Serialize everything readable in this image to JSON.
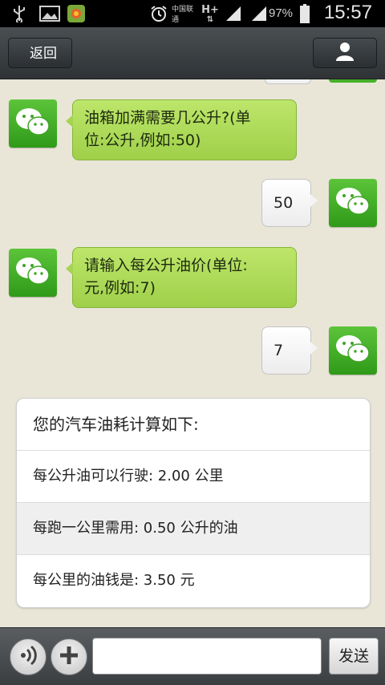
{
  "status_bar": {
    "time": "15:57",
    "battery_percent": "97%",
    "network_label": "H+",
    "carrier_small": "中国联通",
    "icons": [
      "usb-icon",
      "image-icon",
      "app-icon",
      "alarm-icon",
      "carrier-icon",
      "network-data-icon",
      "signal-icon",
      "signal-icon",
      "battery-icon"
    ]
  },
  "header": {
    "back_label": "返回",
    "profile_icon": "person-icon"
  },
  "messages": [
    {
      "side": "in",
      "text_line1": "油箱加满需要几公升?(单",
      "text_line2": "位:公升,例如:50)"
    },
    {
      "side": "out",
      "text": "50"
    },
    {
      "side": "in",
      "text_line1": "请输入每公升油价(单位:",
      "text_line2": "元,例如:7)"
    },
    {
      "side": "out",
      "text": "7"
    }
  ],
  "result_card": {
    "title": "您的汽车油耗计算如下:",
    "rows": [
      "每公升油可以行驶: 2.00 公里",
      "每跑一公里需用: 0.50 公升的油",
      "每公里的油钱是: 3.50 元"
    ]
  },
  "input_bar": {
    "voice_icon": "voice-icon",
    "plus_icon": "plus-icon",
    "input_value": "",
    "send_label": "发送"
  },
  "colors": {
    "chat_bg": "#e9e6d8",
    "incoming_bubble": "#aed85a",
    "outgoing_bubble": "#f4f4f4",
    "avatar_green": "#46b02a",
    "title_bar": "#3b3f42"
  }
}
